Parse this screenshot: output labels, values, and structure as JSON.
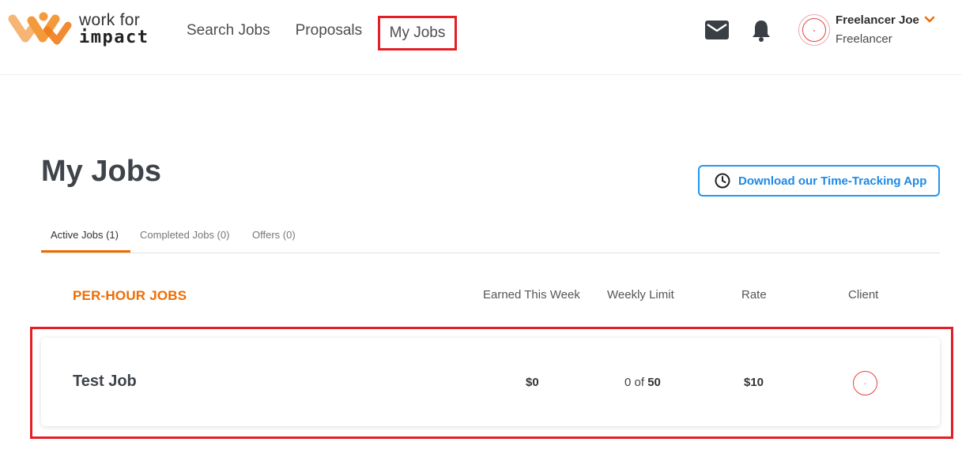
{
  "brand": {
    "line1": "work for",
    "line2": "impact",
    "orange": "#f39a3c",
    "orange_dark": "#ef6c00"
  },
  "nav": {
    "search_jobs": "Search Jobs",
    "proposals": "Proposals",
    "my_jobs": "My Jobs"
  },
  "icons": {
    "mail": "mail-icon",
    "bell": "bell-icon",
    "chevron": "chevron-down-icon"
  },
  "user": {
    "name": "Freelancer Joe",
    "role": "Freelancer"
  },
  "page": {
    "title": "My Jobs",
    "download_button": "Download our Time-Tracking App"
  },
  "tabs": [
    {
      "label": "Active Jobs (1)",
      "active": true
    },
    {
      "label": "Completed Jobs (0)",
      "active": false
    },
    {
      "label": "Offers (0)",
      "active": false
    }
  ],
  "jobs_table": {
    "section_title": "PER-HOUR JOBS",
    "columns": {
      "earned": "Earned This Week",
      "limit": "Weekly Limit",
      "rate": "Rate",
      "client": "Client"
    },
    "rows": [
      {
        "title": "Test Job",
        "earned": "$0",
        "limit_prefix": "0 of ",
        "limit_value": "50",
        "rate": "$10"
      }
    ]
  },
  "colors": {
    "highlight": "#e41e26",
    "accent_blue": "#1e88e5",
    "tab_active": "#ef6c00"
  }
}
